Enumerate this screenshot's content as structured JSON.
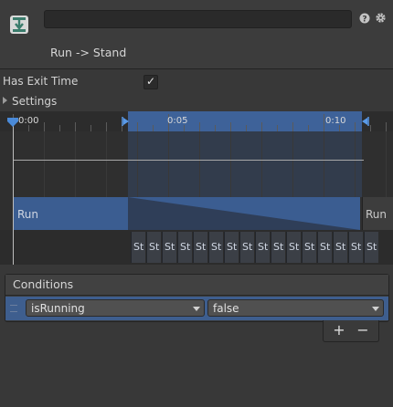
{
  "header": {
    "title": "Run -> Stand",
    "name_value": ""
  },
  "properties": {
    "has_exit_time_label": "Has Exit Time",
    "has_exit_time_checked": true,
    "checkmark": "✓",
    "settings_label": "Settings"
  },
  "timeline": {
    "ruler_labels": [
      "0:00",
      "0:05",
      "0:10"
    ],
    "source_state_label": "Run",
    "next_source_label": "Run",
    "destination_cell_label": "St",
    "destination_cell_count": 16
  },
  "conditions": {
    "title": "Conditions",
    "items": [
      {
        "parameter": "isRunning",
        "value": "false"
      }
    ],
    "add_label": "+",
    "remove_label": "−"
  },
  "icons": {
    "transition": "transition-icon",
    "help": "help-icon",
    "settings": "gear-icon"
  },
  "colors": {
    "accent": "#3e6299",
    "background": "#383838"
  }
}
